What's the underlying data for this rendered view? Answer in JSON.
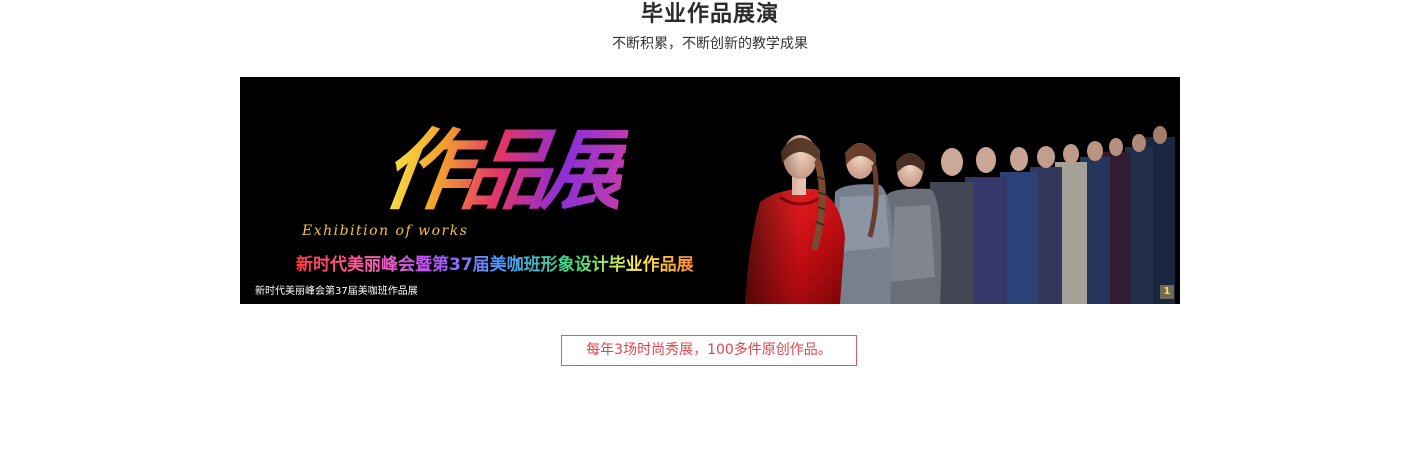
{
  "section": {
    "title": "毕业作品展演",
    "subtitle": "不断积累，不断创新的教学成果"
  },
  "banner": {
    "artwork_title": "作品展",
    "artwork_title_en": "Exhibition of works",
    "event_title": "新时代美丽峰会暨第37届美咖班形象设计毕业作品展",
    "caption": "新时代美丽峰会第37届美咖班作品展",
    "slide_indicator": "1"
  },
  "highlight": {
    "text": "每年3场时尚秀展，100多件原创作品。"
  },
  "colors": {
    "title": "#2b2b2b",
    "accent_red": "#e9585c",
    "banner_bg": "#000000",
    "indicator_bg": "#6d6b53",
    "indicator_text": "#f2e14a"
  }
}
